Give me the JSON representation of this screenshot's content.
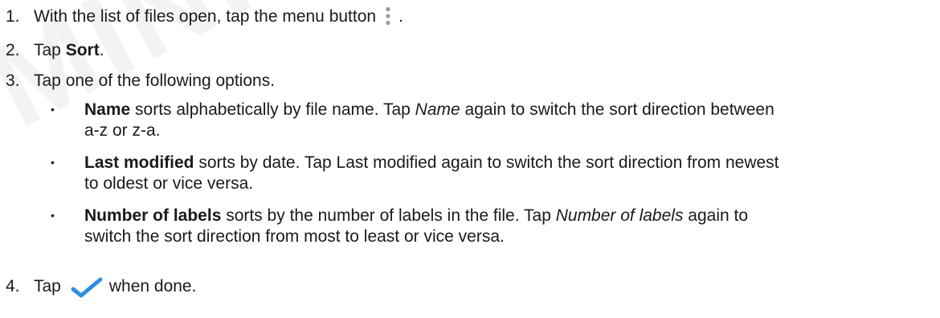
{
  "watermark": "MINIQ",
  "steps": [
    {
      "number": "1.",
      "before_icon": "With the list of files open, tap the menu button",
      "icon": "three-dot-menu-icon",
      "after_icon": "."
    },
    {
      "number": "2.",
      "prefix": "Tap ",
      "bold": "Sort",
      "suffix": "."
    },
    {
      "number": "3.",
      "text": "Tap one of the following options."
    },
    {
      "number": "4.",
      "before_icon": "Tap",
      "icon": "checkmark-icon",
      "after_icon": "when done."
    }
  ],
  "options": [
    {
      "bold": "Name",
      "line1_a": " sorts alphabetically by file name. Tap ",
      "line1_italic": "Name",
      "line1_b": " again to switch the sort direction between",
      "line2": "a-z or z-a."
    },
    {
      "bold": "Last modified",
      "line1_a": " sorts by date. Tap Last modified again to switch the sort direction from newest",
      "line2": "to oldest or vice versa."
    },
    {
      "bold": "Number of labels",
      "line1_a": " sorts by the number of labels in the file. Tap ",
      "line1_italic": "Number of labels",
      "line1_b": " again to",
      "line2": "switch the sort direction from most to least or vice versa."
    }
  ],
  "bullet_char": "•",
  "colors": {
    "text": "#1a1a1a",
    "check": "#2f8fe0",
    "menu_dots": "#9a9a9a"
  }
}
